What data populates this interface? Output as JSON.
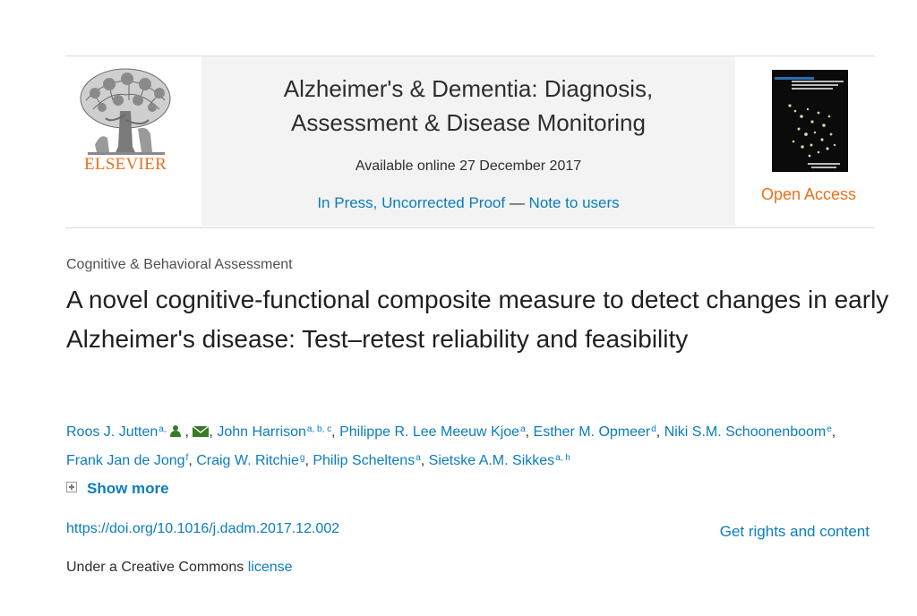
{
  "publisher": {
    "name": "ELSEVIER"
  },
  "journal": {
    "title_line1": "Alzheimer's & Dementia: Diagnosis,",
    "title_line2": "Assessment & Disease Monitoring",
    "available_online": "Available online 27 December 2017",
    "in_press": "In Press, Uncorrected Proof",
    "separator": " — ",
    "note_to_users": "Note to users",
    "open_access": "Open Access"
  },
  "article": {
    "subject": "Cognitive & Behavioral Assessment",
    "title": "A novel cognitive-functional composite measure to detect changes in early Alzheimer's disease: Test–retest reliability and feasibility",
    "authors": [
      {
        "name": "Roos J. Jutten",
        "sup": "a,"
      },
      {
        "name": "John Harrison",
        "sup": "a, b, c"
      },
      {
        "name": "Philippe R. Lee Meeuw Kjoe",
        "sup": "a"
      },
      {
        "name": "Esther M. Opmeer",
        "sup": "d"
      },
      {
        "name": "Niki S.M. Schoonenboom",
        "sup": "e"
      },
      {
        "name": "Frank Jan de Jong",
        "sup": "f"
      },
      {
        "name": "Craig W. Ritchie",
        "sup": "g"
      },
      {
        "name": "Philip Scheltens",
        "sup": "a"
      },
      {
        "name": "Sietske A.M. Sikkes",
        "sup": "a, h"
      }
    ],
    "show_more": "Show more",
    "doi": "https://doi.org/10.1016/j.dadm.2017.12.002",
    "get_rights": "Get rights and content",
    "license_prefix": "Under a Creative Commons ",
    "license_link": "license"
  },
  "icons": {
    "author_profile": "person-icon",
    "author_email": "envelope-icon",
    "show_more": "plus-box-icon"
  },
  "colors": {
    "link": "#0c7dbb",
    "elsevier_orange": "#e9711c",
    "text": "#2e2e2e",
    "banner_bg": "#f3f3f3"
  }
}
